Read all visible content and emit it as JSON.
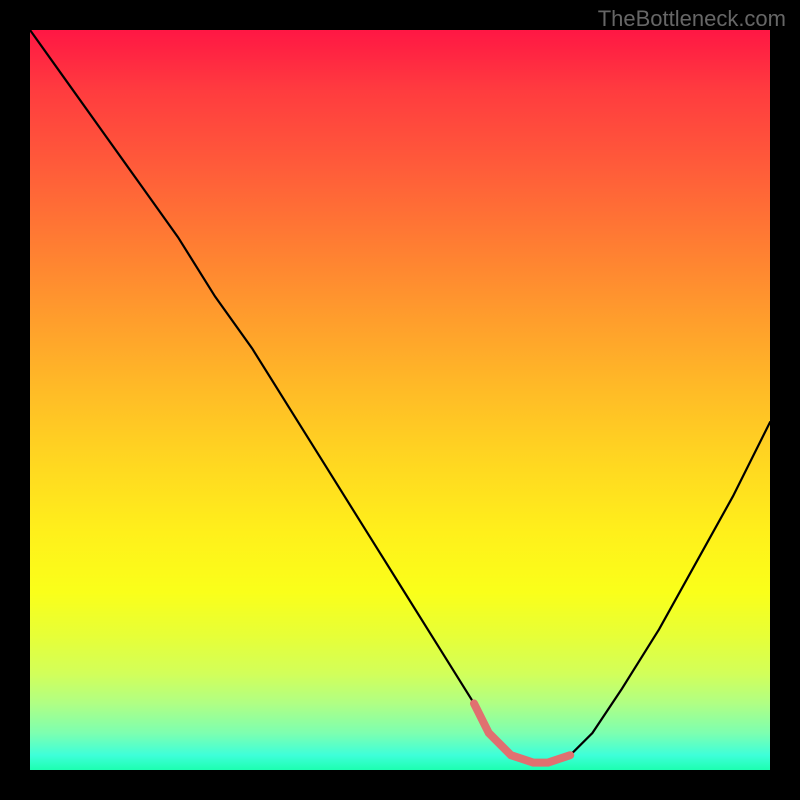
{
  "watermark": "TheBottleneck.com",
  "chart_data": {
    "type": "line",
    "title": "",
    "xlabel": "",
    "ylabel": "",
    "xlim": [
      0,
      100
    ],
    "ylim": [
      0,
      100
    ],
    "x": [
      0,
      5,
      10,
      15,
      20,
      25,
      30,
      35,
      40,
      45,
      50,
      55,
      60,
      62,
      65,
      68,
      70,
      73,
      76,
      80,
      85,
      90,
      95,
      100
    ],
    "values": [
      100,
      93,
      86,
      79,
      72,
      64,
      57,
      49,
      41,
      33,
      25,
      17,
      9,
      5,
      2,
      1,
      1,
      2,
      5,
      11,
      19,
      28,
      37,
      47
    ],
    "gradient_stops": [
      {
        "pos": 0,
        "color": "#ff1744"
      },
      {
        "pos": 50,
        "color": "#ffd621"
      },
      {
        "pos": 80,
        "color": "#faff1a"
      },
      {
        "pos": 100,
        "color": "#1dffb0"
      }
    ],
    "highlight_segment": {
      "x_start": 60,
      "x_end": 73,
      "color": "#e07070",
      "thickness": 8
    }
  }
}
